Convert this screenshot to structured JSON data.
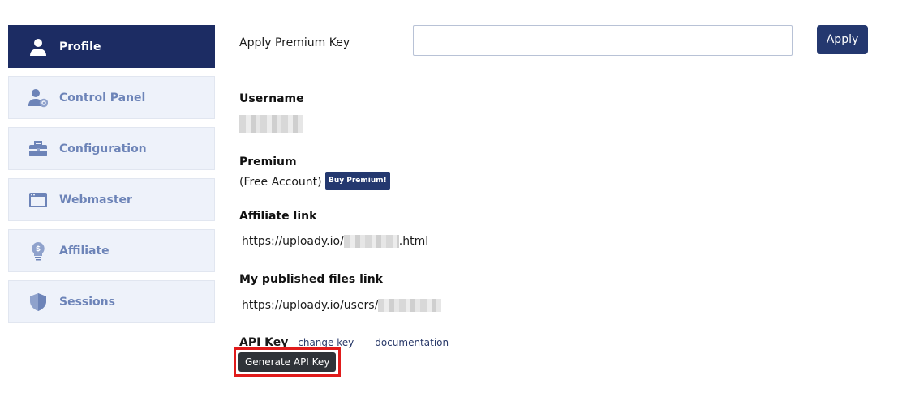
{
  "sidebar": {
    "items": [
      {
        "label": "Profile",
        "icon": "user-icon",
        "active": true
      },
      {
        "label": "Control Panel",
        "icon": "user-gear-icon",
        "active": false
      },
      {
        "label": "Configuration",
        "icon": "toolbox-icon",
        "active": false
      },
      {
        "label": "Webmaster",
        "icon": "browser-window-icon",
        "active": false
      },
      {
        "label": "Affiliate",
        "icon": "lightbulb-dollar-icon",
        "active": false
      },
      {
        "label": "Sessions",
        "icon": "shield-icon",
        "active": false
      }
    ]
  },
  "premium_key": {
    "label": "Apply Premium Key",
    "value": "",
    "apply_label": "Apply"
  },
  "profile": {
    "username_label": "Username",
    "premium_label": "Premium",
    "premium_status": "(Free Account)",
    "buy_label": "Buy Premium!",
    "affiliate_label": "Affiliate link",
    "affiliate_prefix": "https://uploady.io/",
    "affiliate_suffix": ".html",
    "published_label": "My published files link",
    "published_prefix": "https://uploady.io/users/",
    "api_label": "API Key",
    "change_key_label": "change key",
    "separator": "-",
    "documentation_label": "documentation",
    "generate_label": "Generate API Key"
  },
  "colors": {
    "accent": "#1c2c63",
    "button": "#24386f",
    "sidebar_bg": "#eef2fa",
    "sidebar_text": "#6d84b8",
    "highlight": "#e01b1b"
  }
}
